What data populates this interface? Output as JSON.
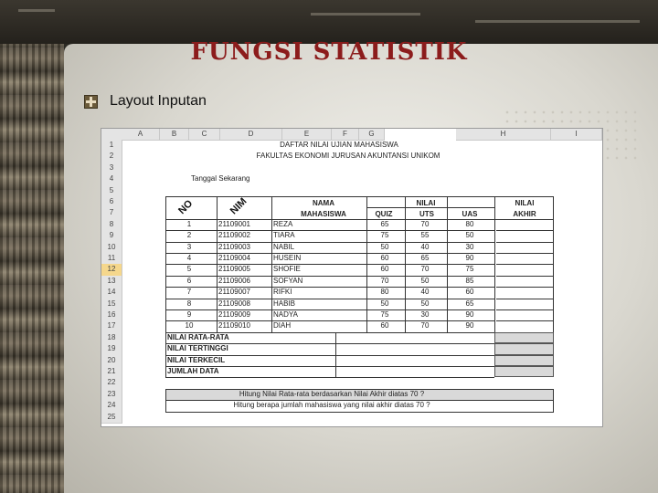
{
  "slide": {
    "title": "FUNGSI STATISTIK",
    "bullet": "Layout Inputan"
  },
  "sheet": {
    "columns": [
      "A",
      "B",
      "C",
      "D",
      "E",
      "F",
      "G",
      "H",
      "I"
    ],
    "rows": [
      "1",
      "2",
      "3",
      "4",
      "5",
      "6",
      "7",
      "8",
      "9",
      "10",
      "11",
      "12",
      "13",
      "14",
      "15",
      "16",
      "17",
      "18",
      "19",
      "20",
      "21",
      "22",
      "23",
      "24",
      "25"
    ],
    "title1": "DAFTAR NILAI UJIAN MAHASISWA",
    "title2": "FAKULTAS EKONOMI JURUSAN AKUNTANSI UNIKOM",
    "tanggal": "Tanggal Sekarang",
    "headers": {
      "no": "NO",
      "nim": "NIM",
      "nama1": "NAMA",
      "nama2": "MAHASISWA",
      "nilai": "NILAI",
      "quiz": "QUIZ",
      "uts": "UTS",
      "uas": "UAS",
      "akhir1": "NILAI",
      "akhir2": "AKHIR"
    },
    "data": [
      {
        "no": "1",
        "nim": "21109001",
        "nama": "REZA",
        "quiz": "65",
        "uts": "70",
        "uas": "80"
      },
      {
        "no": "2",
        "nim": "21109002",
        "nama": "TIARA",
        "quiz": "75",
        "uts": "55",
        "uas": "50"
      },
      {
        "no": "3",
        "nim": "21109003",
        "nama": "NABIL",
        "quiz": "50",
        "uts": "40",
        "uas": "30"
      },
      {
        "no": "4",
        "nim": "21109004",
        "nama": "HUSEIN",
        "quiz": "60",
        "uts": "65",
        "uas": "90"
      },
      {
        "no": "5",
        "nim": "21109005",
        "nama": "SHOFIE",
        "quiz": "60",
        "uts": "70",
        "uas": "75"
      },
      {
        "no": "6",
        "nim": "21109006",
        "nama": "SOFYAN",
        "quiz": "70",
        "uts": "50",
        "uas": "85"
      },
      {
        "no": "7",
        "nim": "21109007",
        "nama": "RIFKI",
        "quiz": "80",
        "uts": "40",
        "uas": "60"
      },
      {
        "no": "8",
        "nim": "21109008",
        "nama": "HABIB",
        "quiz": "50",
        "uts": "50",
        "uas": "65"
      },
      {
        "no": "9",
        "nim": "21109009",
        "nama": "NADYA",
        "quiz": "75",
        "uts": "30",
        "uas": "90"
      },
      {
        "no": "10",
        "nim": "21109010",
        "nama": "DIAH",
        "quiz": "60",
        "uts": "70",
        "uas": "90"
      }
    ],
    "summary": [
      "NILAI RATA-RATA",
      "NILAI TERTINGGI",
      "NILAI TERKECIL",
      "JUMLAH DATA"
    ],
    "q1": "Hitung Nilai Rata-rata berdasarkan Nilai Akhir diatas 70 ?",
    "q2": "Hitung berapa jumlah mahasiswa yang nilai akhir diatas 70 ?",
    "selected_row": "12"
  }
}
